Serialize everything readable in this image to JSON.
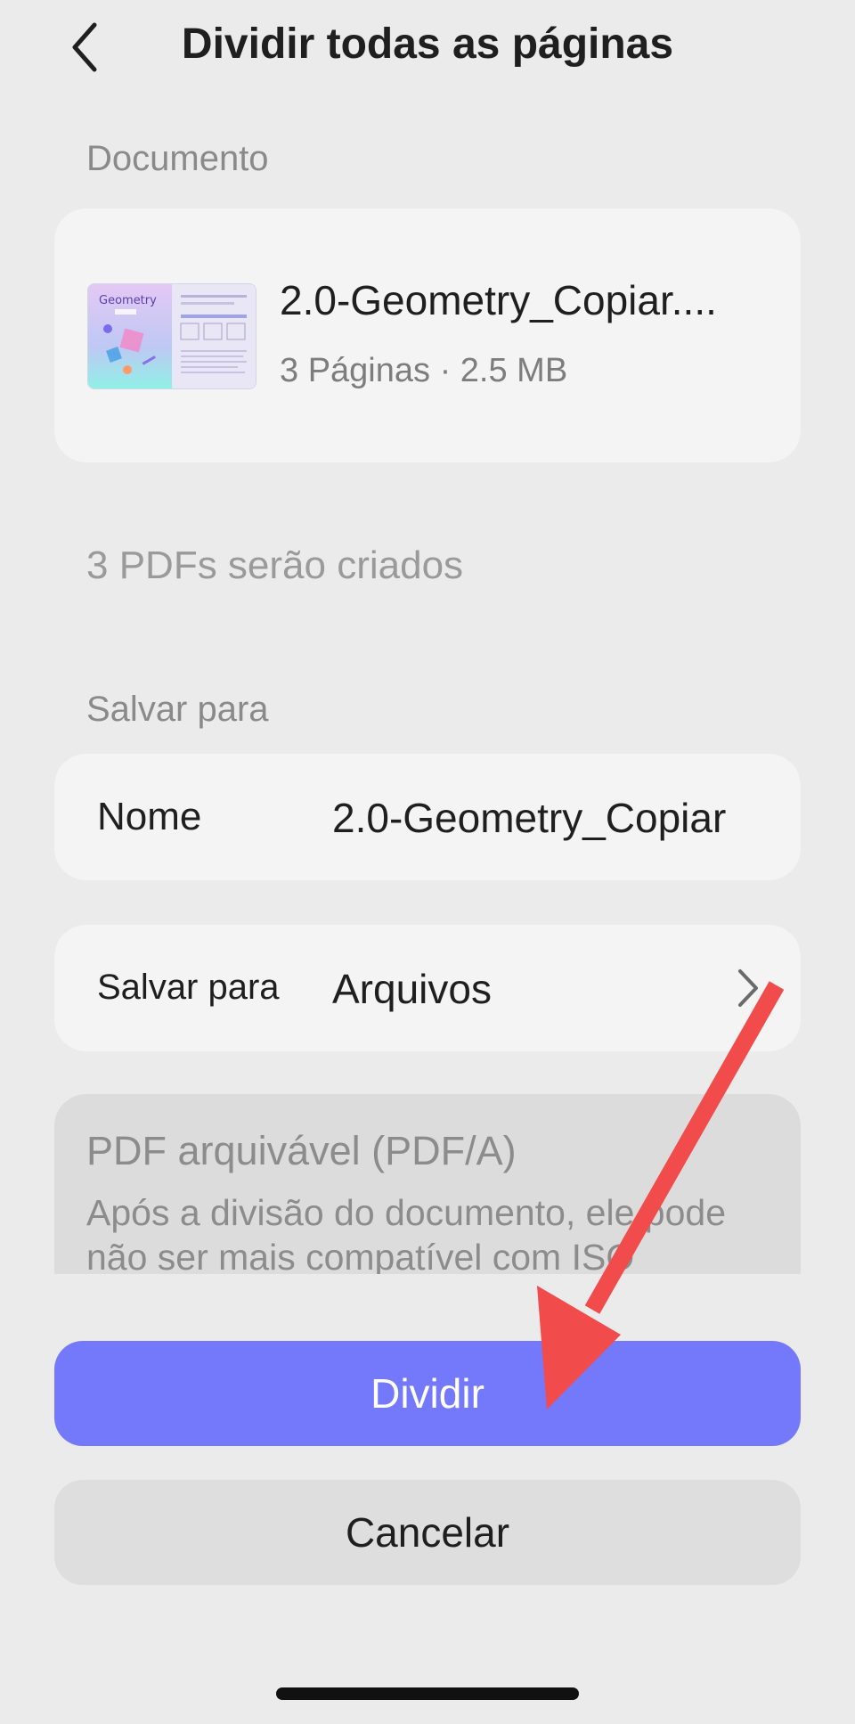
{
  "header": {
    "title": "Dividir todas as páginas"
  },
  "document": {
    "section_label": "Documento",
    "thumbnail_text": "Geometry",
    "file_name": "2.0-Geometry_Copiar....",
    "file_meta": "3 Páginas · 2.5 MB"
  },
  "summary": {
    "text": "3 PDFs serão criados"
  },
  "save": {
    "section_label": "Salvar para",
    "name_label": "Nome",
    "name_value": "2.0-Geometry_Copiar",
    "location_label": "Salvar para",
    "location_value": "Arquivos"
  },
  "pdfa": {
    "title": "PDF arquivável (PDF/A)",
    "description": "Após a divisão do documento, ele pode não ser mais compatível com ISO"
  },
  "actions": {
    "primary": "Dividir",
    "secondary": "Cancelar"
  },
  "colors": {
    "accent": "#7479fb",
    "arrow": "#f24b4b"
  }
}
